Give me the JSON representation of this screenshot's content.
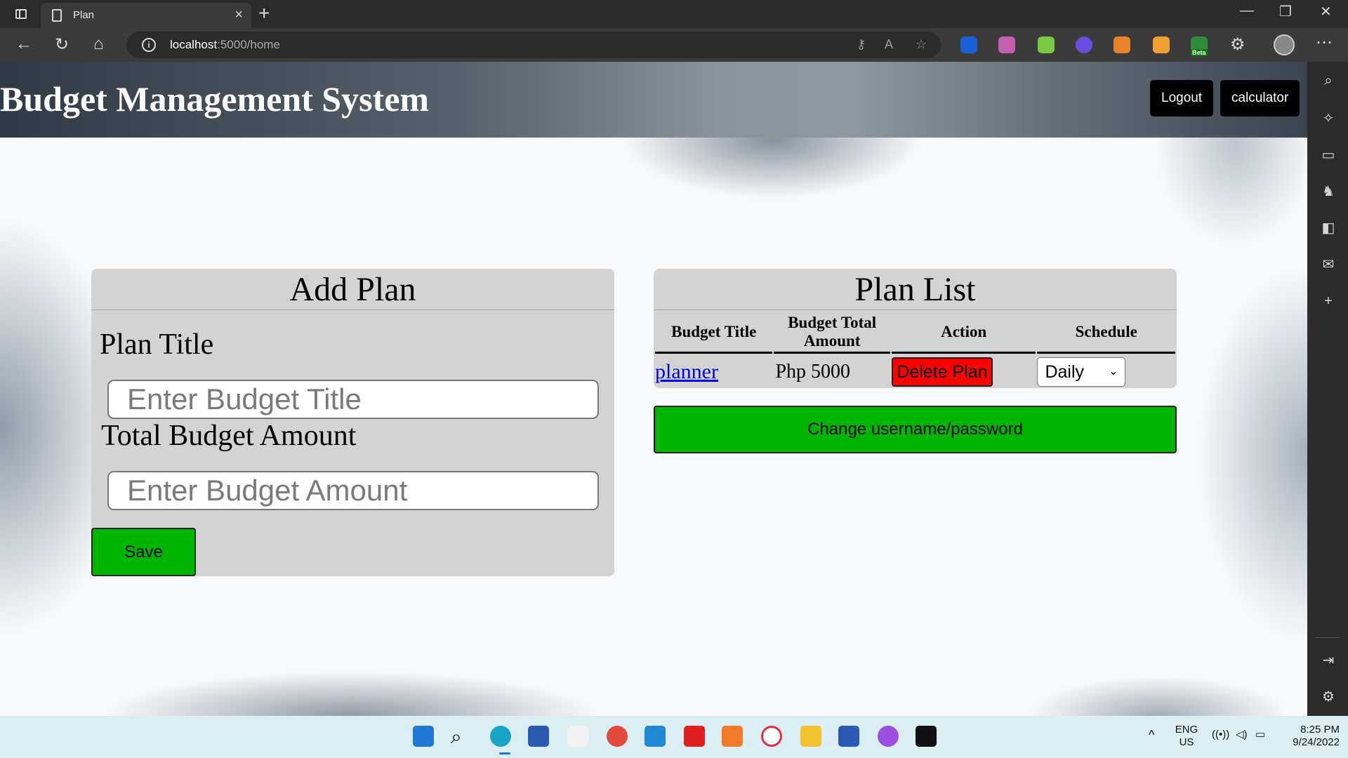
{
  "browser": {
    "tab_title": "Plan",
    "tab_close": "×",
    "new_tab": "+",
    "url_host": "localhost",
    "url_rest": ":5000/home",
    "info": "i",
    "window_controls": {
      "minimize": "—",
      "restore": "❐",
      "close": "✕"
    }
  },
  "header": {
    "site_title": "Budget Management System",
    "logout_label": "Logout",
    "calculator_label": "calculator"
  },
  "add_plan": {
    "heading": "Add Plan",
    "plan_title_label": "Plan Title",
    "plan_title_placeholder": "Enter Budget Title",
    "plan_title_value": "",
    "amount_label": "Total Budget Amount",
    "amount_placeholder": "Enter Budget Amount",
    "amount_value": "",
    "save_label": "Save"
  },
  "plan_list": {
    "heading": "Plan List",
    "columns": [
      "Budget Title",
      "Budget Total Amount",
      "Action",
      "Schedule"
    ],
    "rows": [
      {
        "title": "planner",
        "amount": "Php 5000",
        "action": "Delete Plan",
        "schedule": "Daily"
      }
    ],
    "change_credentials_label": "Change username/password"
  },
  "taskbar": {
    "language": "ENG",
    "region": "US",
    "time": "8:25 PM",
    "date": "9/24/2022"
  },
  "colors": {
    "save_green": "#00b400",
    "delete_red": "#ff0000",
    "panel_gray": "#d3d3d3",
    "link_blue": "#0000ee"
  },
  "icons": {
    "toolbar": [
      "back-icon",
      "reload-icon",
      "home-icon"
    ],
    "address_bar": [
      "info-icon",
      "key-icon",
      "read-aloud-icon",
      "favorites-icon"
    ],
    "sidebar": [
      "search-icon",
      "sparkle-icon",
      "briefcase-icon",
      "games-icon",
      "office-icon",
      "outlook-icon",
      "add-icon",
      "panel-icon",
      "settings-icon"
    ]
  }
}
